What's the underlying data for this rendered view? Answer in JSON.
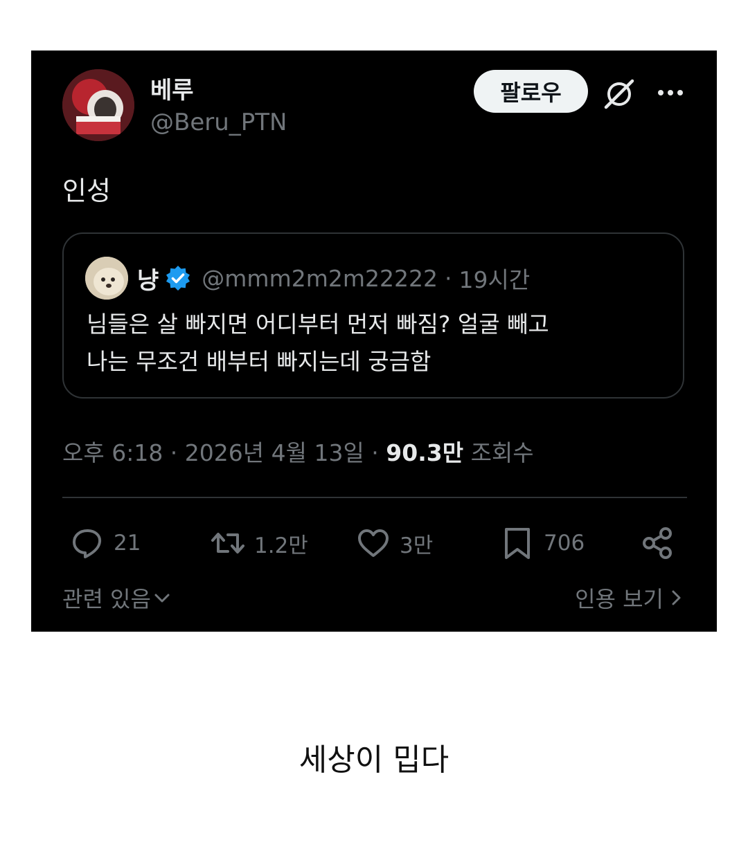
{
  "tweet": {
    "author": {
      "display_name": "베루",
      "handle": "@Beru_PTN"
    },
    "follow_label": "팔로우",
    "text": "인성",
    "quote": {
      "display_name": "냥",
      "handle": "@mmm2m2m22222",
      "separator": "·",
      "time_ago": "19시간",
      "text_line1": "님들은 살 빠지면 어디부터 먼저 빠짐? 얼굴 빼고",
      "text_line2": "나는 무조건 배부터 빠지는데 궁금함"
    },
    "timestamp": "오후 6:18 · 2026년 4월 13일 · ",
    "views": "90.3만",
    "views_label": " 조회수",
    "actions": {
      "replies": "21",
      "retweets": "1.2만",
      "likes": "3만",
      "bookmarks": "706"
    },
    "related_label": "관련 있음",
    "quotes_label": "인용 보기"
  },
  "caption": "세상이 밉다",
  "colors": {
    "background": "#000000",
    "text": "#e7e9ea",
    "muted": "#71767b",
    "border": "#2f3336",
    "verified": "#1d9bf0"
  },
  "icons": [
    "grok-icon",
    "more-icon",
    "verified-badge-icon",
    "reply-icon",
    "retweet-icon",
    "like-icon",
    "bookmark-icon",
    "share-icon",
    "chevron-down-icon",
    "chevron-right-icon"
  ]
}
